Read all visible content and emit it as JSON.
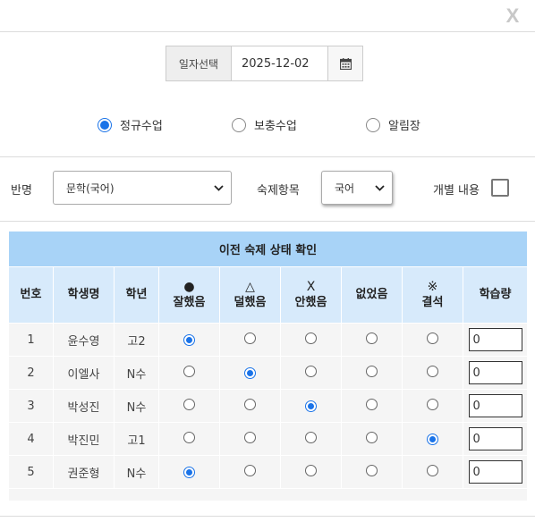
{
  "close_label": "X",
  "date": {
    "label": "일자선택",
    "value": "2025-12-02"
  },
  "class_types": [
    {
      "label": "정규수업",
      "checked": true
    },
    {
      "label": "보충수업",
      "checked": false
    },
    {
      "label": "알림장",
      "checked": false
    }
  ],
  "filters": {
    "class_label": "반명",
    "class_value": "문학(국어)",
    "subject_label": "숙제항목",
    "subject_value": "국어",
    "individual_label": "개별 내용"
  },
  "table": {
    "title": "이전 숙제 상태 확인",
    "columns": [
      {
        "label": "번호",
        "symbol": ""
      },
      {
        "label": "학생명",
        "symbol": ""
      },
      {
        "label": "학년",
        "symbol": ""
      },
      {
        "label": "잘했음",
        "symbol": "●"
      },
      {
        "label": "덜했음",
        "symbol": "△"
      },
      {
        "label": "안했음",
        "symbol": "X"
      },
      {
        "label": "없었음",
        "symbol": ""
      },
      {
        "label": "결석",
        "symbol": "※"
      },
      {
        "label": "학습량",
        "symbol": ""
      }
    ],
    "rows": [
      {
        "no": "1",
        "name": "윤수영",
        "grade": "고2",
        "status": 0,
        "amount": "0"
      },
      {
        "no": "2",
        "name": "이엘사",
        "grade": "N수",
        "status": 1,
        "amount": "0"
      },
      {
        "no": "3",
        "name": "박성진",
        "grade": "N수",
        "status": 2,
        "amount": "0"
      },
      {
        "no": "4",
        "name": "박진민",
        "grade": "고1",
        "status": 4,
        "amount": "0"
      },
      {
        "no": "5",
        "name": "권준형",
        "grade": "N수",
        "status": 0,
        "amount": "0"
      }
    ]
  },
  "colors": {
    "accent": "#1a73e8",
    "title_bg": "#a8d3f7",
    "header_bg": "#d7eafb"
  }
}
